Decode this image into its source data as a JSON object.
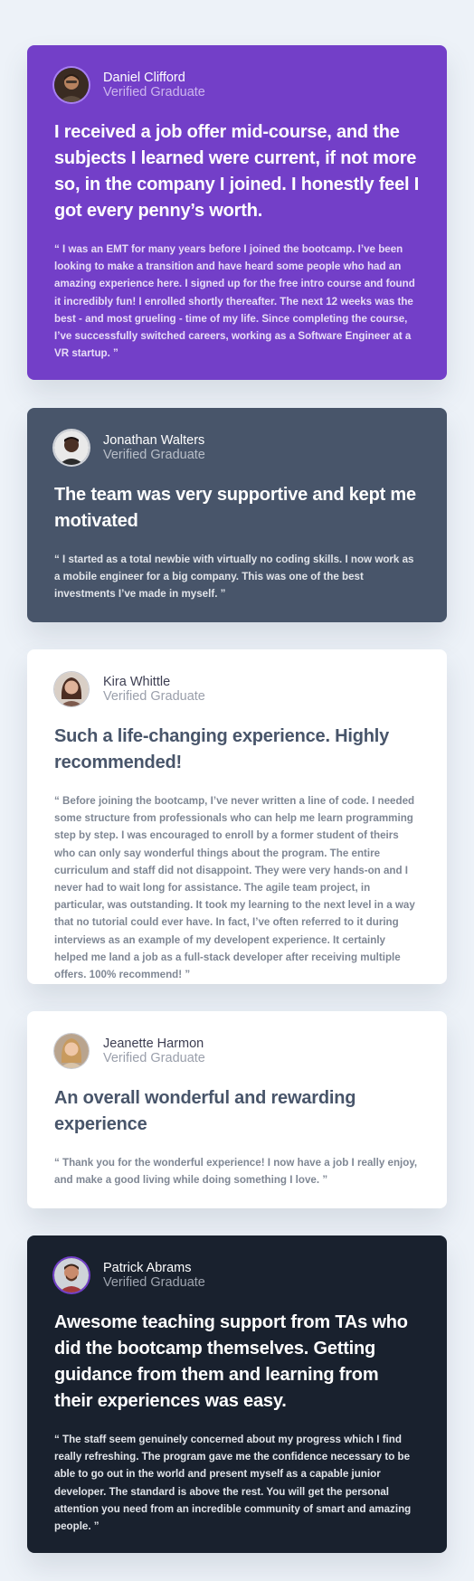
{
  "colors": {
    "background": "#edf2f8",
    "purple": "#733fc8",
    "gray_blue": "#48556a",
    "white": "#ffffff",
    "dark": "#19212e"
  },
  "testimonials": [
    {
      "name": "Daniel Clifford",
      "role": "Verified Graduate",
      "avatar_icon": "avatar-daniel-clifford",
      "headline": "I received a job offer mid-course, and the subjects I learned were current, if not more so, in the company I joined. I honestly feel I got every penny’s worth.",
      "quote": "“ I was an EMT for many years before I joined the bootcamp. I’ve been looking to make a transition and have heard some people who had an amazing experience here. I signed up for the free intro course and found it incredibly fun! I enrolled shortly thereafter. The next 12 weeks was the best - and most grueling - time of my life. Since completing the course, I’ve successfully switched careers, working as a Software Engineer at a VR startup. ”"
    },
    {
      "name": "Jonathan Walters",
      "role": "Verified Graduate",
      "avatar_icon": "avatar-jonathan-walters",
      "headline": "The team was very supportive and kept me motivated",
      "quote": "“ I started as a total newbie with virtually no coding skills. I now work as a mobile engineer for a big company. This was one of the best investments I’ve made in myself. ”"
    },
    {
      "name": "Kira Whittle",
      "role": "Verified Graduate",
      "avatar_icon": "avatar-kira-whittle",
      "headline": "Such a life-changing experience. Highly recommended!",
      "quote": "“ Before joining the bootcamp, I’ve never written a line of code. I needed some structure from professionals who can help me learn programming step by step. I was encouraged to enroll by a former student of theirs who can only say wonderful things about the program. The entire curriculum and staff did not disappoint. They were very hands-on and I never had to wait long for assistance. The agile team project, in particular, was outstanding. It took my learning to the next level in a way that no tutorial could ever have. In fact, I’ve often referred to it during interviews as an example of my developent experience. It certainly helped me land a job as a full-stack developer after receiving multiple offers. 100% recommend! ”"
    },
    {
      "name": "Jeanette Harmon",
      "role": "Verified Graduate",
      "avatar_icon": "avatar-jeanette-harmon",
      "headline": "An overall wonderful and rewarding experience",
      "quote": "“ Thank you for the wonderful experience! I now have a job I really enjoy, and make a good living while doing something I love. ”"
    },
    {
      "name": "Patrick Abrams",
      "role": "Verified Graduate",
      "avatar_icon": "avatar-patrick-abrams",
      "headline": "Awesome teaching support from TAs who did the bootcamp themselves. Getting guidance from them and learning from their experiences was easy.",
      "quote": "“ The staff seem genuinely concerned about my progress which I find really refreshing. The program gave me the confidence necessary to be able to go out in the world and present myself as a capable junior developer. The standard is above the rest. You will get the personal attention you need from an incredible community of smart and amazing people. ”"
    }
  ]
}
